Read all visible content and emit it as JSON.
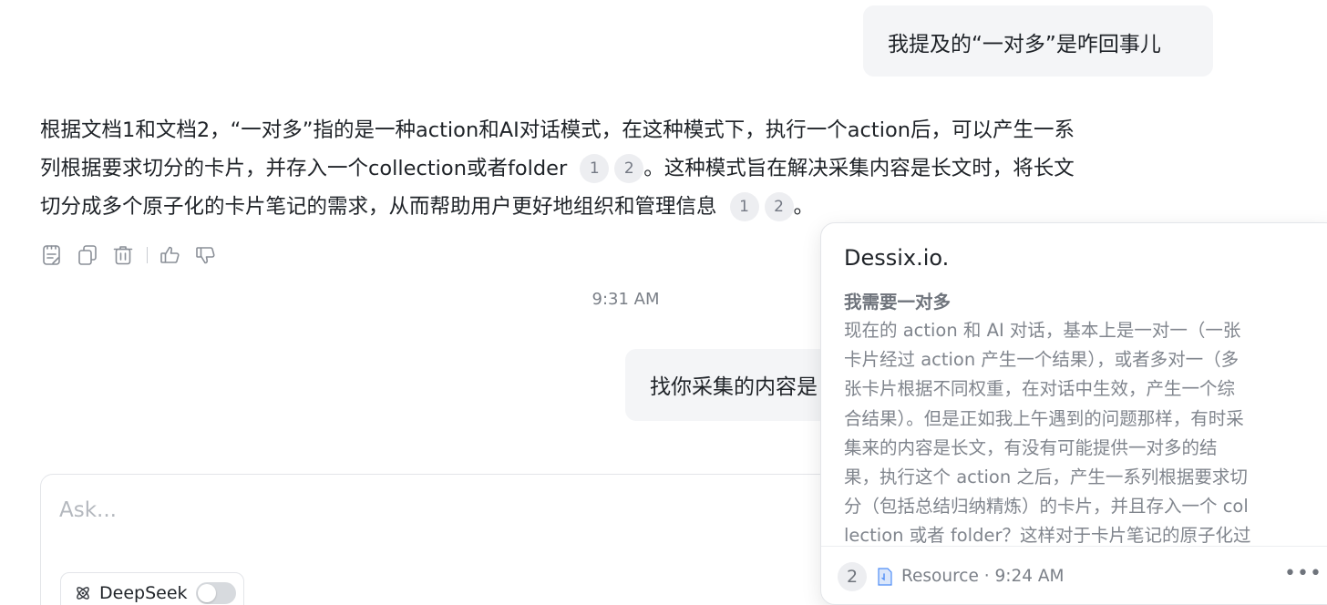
{
  "chat": {
    "user_message_1": "我提及的“一对多”是咋回事儿",
    "assistant_answer": {
      "line1": "根据文档1和文档2，“一对多”指的是一种action和AI对话模式，在这种模式下，执行一个action后，可以产生一系",
      "line2": "列根据要求切分的卡片，并存入一个collection或者folder",
      "line2_tail": "。这种模式旨在解决采集内容是长文时，将长文",
      "line3": "切分成多个原子化的卡片笔记的需求，从而帮助用户更好地组织和管理信息",
      "line3_tail": "。",
      "citations_a": [
        "1",
        "2"
      ],
      "citations_b": [
        "1",
        "2"
      ]
    },
    "timestamp": "9:31 AM",
    "user_message_2": "找你采集的内容是"
  },
  "message_actions": [
    "note-icon",
    "copy-icon",
    "trash-icon",
    "thumbs-up-icon",
    "thumbs-down-icon"
  ],
  "composer": {
    "placeholder": "Ask...",
    "model_label": "DeepSeek",
    "model_toggle_on": false
  },
  "source_popover": {
    "title": "Dessix.io.",
    "heading": "我需要一对多",
    "body_lines": [
      "现在的 action 和 AI 对话，基本上是一对一（一张",
      "卡片经过 action 产生一个结果），或者多对一（多",
      "张卡片根据不同权重，在对话中生效，产生一个综",
      "合结果）。但是正如我上午遇到的问题那样，有时采",
      "集来的内容是长文，有没有可能提供一对多的结",
      "果，执行这个 action 之后，产生一系列根据要求切",
      "分（包括总结归纳精炼）的卡片，并且存入一个 col",
      "lection 或者 folder？这样对于卡片笔记的原子化过"
    ],
    "count": "2",
    "meta": "Resource · 9:24 AM",
    "more_label": "•••"
  },
  "colors": {
    "bubble_bg": "#f4f5f7",
    "citation_bg": "#edeef1",
    "muted_text": "#80858d",
    "resource_icon": "#4f8ef7"
  }
}
